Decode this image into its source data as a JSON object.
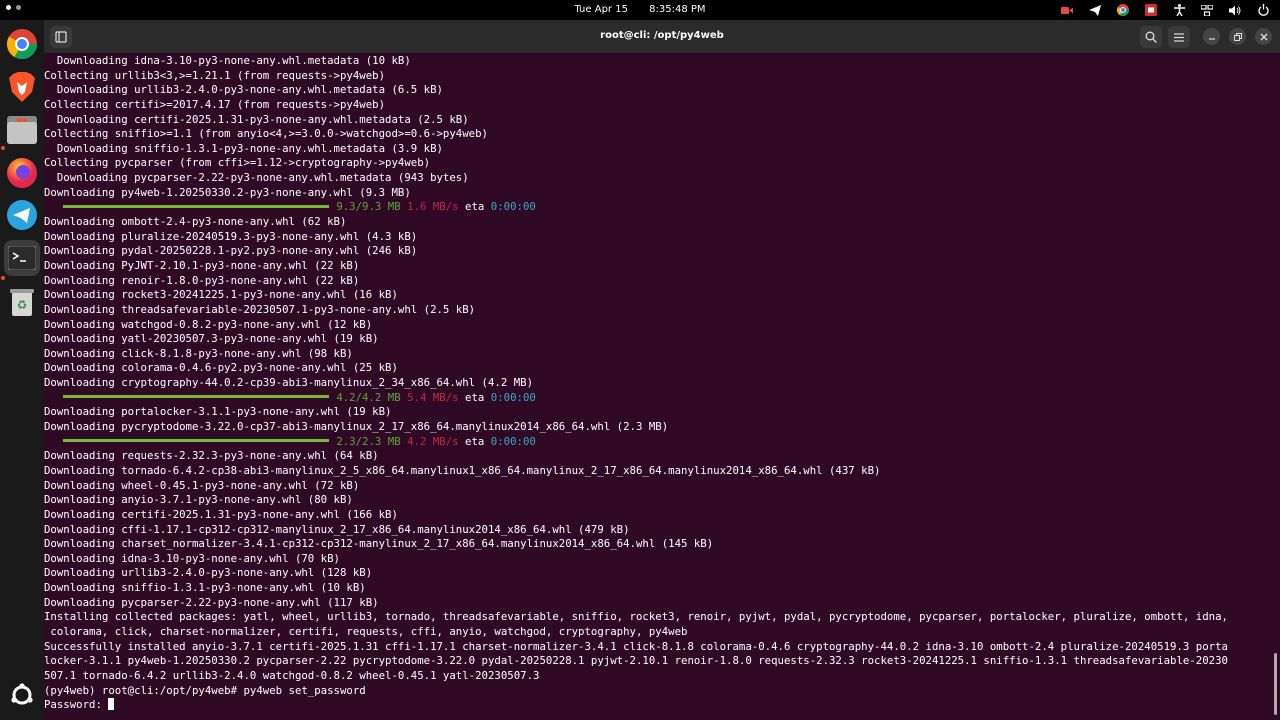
{
  "topbar": {
    "date": "Tue Apr 15",
    "time": "8:35:48 PM",
    "tray_icons": [
      "video-recorder-icon",
      "telegram-icon",
      "chrome-icon",
      "screencast-icon",
      "accessibility-icon",
      "network-icon",
      "volume-icon",
      "power-icon"
    ]
  },
  "dock": {
    "items": [
      {
        "name": "chrome",
        "icon": "chrome-icon"
      },
      {
        "name": "brave",
        "icon": "brave-icon"
      },
      {
        "name": "files",
        "icon": "files-icon"
      },
      {
        "name": "firefox",
        "icon": "firefox-icon"
      },
      {
        "name": "telegram",
        "icon": "telegram-icon"
      },
      {
        "name": "terminal",
        "icon": "terminal-icon"
      },
      {
        "name": "trash",
        "icon": "trash-icon"
      },
      {
        "name": "show-apps",
        "icon": "ubuntu-apps-icon"
      }
    ]
  },
  "window": {
    "title": "root@cli: /opt/py4web"
  },
  "colors": {
    "terminal_bg": "#300a24",
    "progress_green": "#79b93a",
    "speed_red": "#c3274a",
    "eta_cyan": "#3aa8c1"
  },
  "terminal": {
    "lines": [
      {
        "text": "  Downloading idna-3.10-py3-none-any.whl.metadata (10 kB)"
      },
      {
        "text": "Collecting urllib3<3,>=1.21.1 (from requests->py4web)"
      },
      {
        "text": "  Downloading urllib3-2.4.0-py3-none-any.whl.metadata (6.5 kB)"
      },
      {
        "text": "Collecting certifi>=2017.4.17 (from requests->py4web)"
      },
      {
        "text": "  Downloading certifi-2025.1.31-py3-none-any.whl.metadata (2.5 kB)"
      },
      {
        "text": "Collecting sniffio>=1.1 (from anyio<4,>=3.0.0->watchgod>=0.6->py4web)"
      },
      {
        "text": "  Downloading sniffio-1.3.1-py3-none-any.whl.metadata (3.9 kB)"
      },
      {
        "text": "Collecting pycparser (from cffi>=1.12->cryptography->py4web)"
      },
      {
        "text": "  Downloading pycparser-2.22-py3-none-any.whl.metadata (943 bytes)"
      },
      {
        "text": "Downloading py4web-1.20250330.2-py3-none-any.whl (9.3 MB)"
      },
      {
        "progress": {
          "indent": "   ",
          "size": "9.3/9.3 MB",
          "speed": "1.6 MB/s",
          "eta_label": "eta",
          "eta": "0:00:00"
        }
      },
      {
        "text": "Downloading ombott-2.4-py3-none-any.whl (62 kB)"
      },
      {
        "text": "Downloading pluralize-20240519.3-py3-none-any.whl (4.3 kB)"
      },
      {
        "text": "Downloading pydal-20250228.1-py2.py3-none-any.whl (246 kB)"
      },
      {
        "text": "Downloading PyJWT-2.10.1-py3-none-any.whl (22 kB)"
      },
      {
        "text": "Downloading renoir-1.8.0-py3-none-any.whl (22 kB)"
      },
      {
        "text": "Downloading rocket3-20241225.1-py3-none-any.whl (16 kB)"
      },
      {
        "text": "Downloading threadsafevariable-20230507.1-py3-none-any.whl (2.5 kB)"
      },
      {
        "text": "Downloading watchgod-0.8.2-py3-none-any.whl (12 kB)"
      },
      {
        "text": "Downloading yatl-20230507.3-py3-none-any.whl (19 kB)"
      },
      {
        "text": "Downloading click-8.1.8-py3-none-any.whl (98 kB)"
      },
      {
        "text": "Downloading colorama-0.4.6-py2.py3-none-any.whl (25 kB)"
      },
      {
        "text": "Downloading cryptography-44.0.2-cp39-abi3-manylinux_2_34_x86_64.whl (4.2 MB)"
      },
      {
        "progress": {
          "indent": "   ",
          "size": "4.2/4.2 MB",
          "speed": "5.4 MB/s",
          "eta_label": "eta",
          "eta": "0:00:00"
        }
      },
      {
        "text": "Downloading portalocker-3.1.1-py3-none-any.whl (19 kB)"
      },
      {
        "text": "Downloading pycryptodome-3.22.0-cp37-abi3-manylinux_2_17_x86_64.manylinux2014_x86_64.whl (2.3 MB)"
      },
      {
        "progress": {
          "indent": "   ",
          "size": "2.3/2.3 MB",
          "speed": "4.2 MB/s",
          "eta_label": "eta",
          "eta": "0:00:00"
        }
      },
      {
        "text": "Downloading requests-2.32.3-py3-none-any.whl (64 kB)"
      },
      {
        "text": "Downloading tornado-6.4.2-cp38-abi3-manylinux_2_5_x86_64.manylinux1_x86_64.manylinux_2_17_x86_64.manylinux2014_x86_64.whl (437 kB)"
      },
      {
        "text": "Downloading wheel-0.45.1-py3-none-any.whl (72 kB)"
      },
      {
        "text": "Downloading anyio-3.7.1-py3-none-any.whl (80 kB)"
      },
      {
        "text": "Downloading certifi-2025.1.31-py3-none-any.whl (166 kB)"
      },
      {
        "text": "Downloading cffi-1.17.1-cp312-cp312-manylinux_2_17_x86_64.manylinux2014_x86_64.whl (479 kB)"
      },
      {
        "text": "Downloading charset_normalizer-3.4.1-cp312-cp312-manylinux_2_17_x86_64.manylinux2014_x86_64.whl (145 kB)"
      },
      {
        "text": "Downloading idna-3.10-py3-none-any.whl (70 kB)"
      },
      {
        "text": "Downloading urllib3-2.4.0-py3-none-any.whl (128 kB)"
      },
      {
        "text": "Downloading sniffio-1.3.1-py3-none-any.whl (10 kB)"
      },
      {
        "text": "Downloading pycparser-2.22-py3-none-any.whl (117 kB)"
      },
      {
        "text": "Installing collected packages: yatl, wheel, urllib3, tornado, threadsafevariable, sniffio, rocket3, renoir, pyjwt, pydal, pycryptodome, pycparser, portalocker, pluralize, ombott, idna,"
      },
      {
        "text": " colorama, click, charset-normalizer, certifi, requests, cffi, anyio, watchgod, cryptography, py4web"
      },
      {
        "text": "Successfully installed anyio-3.7.1 certifi-2025.1.31 cffi-1.17.1 charset-normalizer-3.4.1 click-8.1.8 colorama-0.4.6 cryptography-44.0.2 idna-3.10 ombott-2.4 pluralize-20240519.3 porta"
      },
      {
        "text": "locker-3.1.1 py4web-1.20250330.2 pycparser-2.22 pycryptodome-3.22.0 pydal-20250228.1 pyjwt-2.10.1 renoir-1.8.0 requests-2.32.3 rocket3-20241225.1 sniffio-1.3.1 threadsafevariable-20230"
      },
      {
        "text": "507.1 tornado-6.4.2 urllib3-2.4.0 watchgod-0.8.2 wheel-0.45.1 yatl-20230507.3"
      },
      {
        "text": "(py4web) root@cli:/opt/py4web# py4web set_password"
      },
      {
        "text": "Password: ",
        "cursor": true
      }
    ]
  }
}
